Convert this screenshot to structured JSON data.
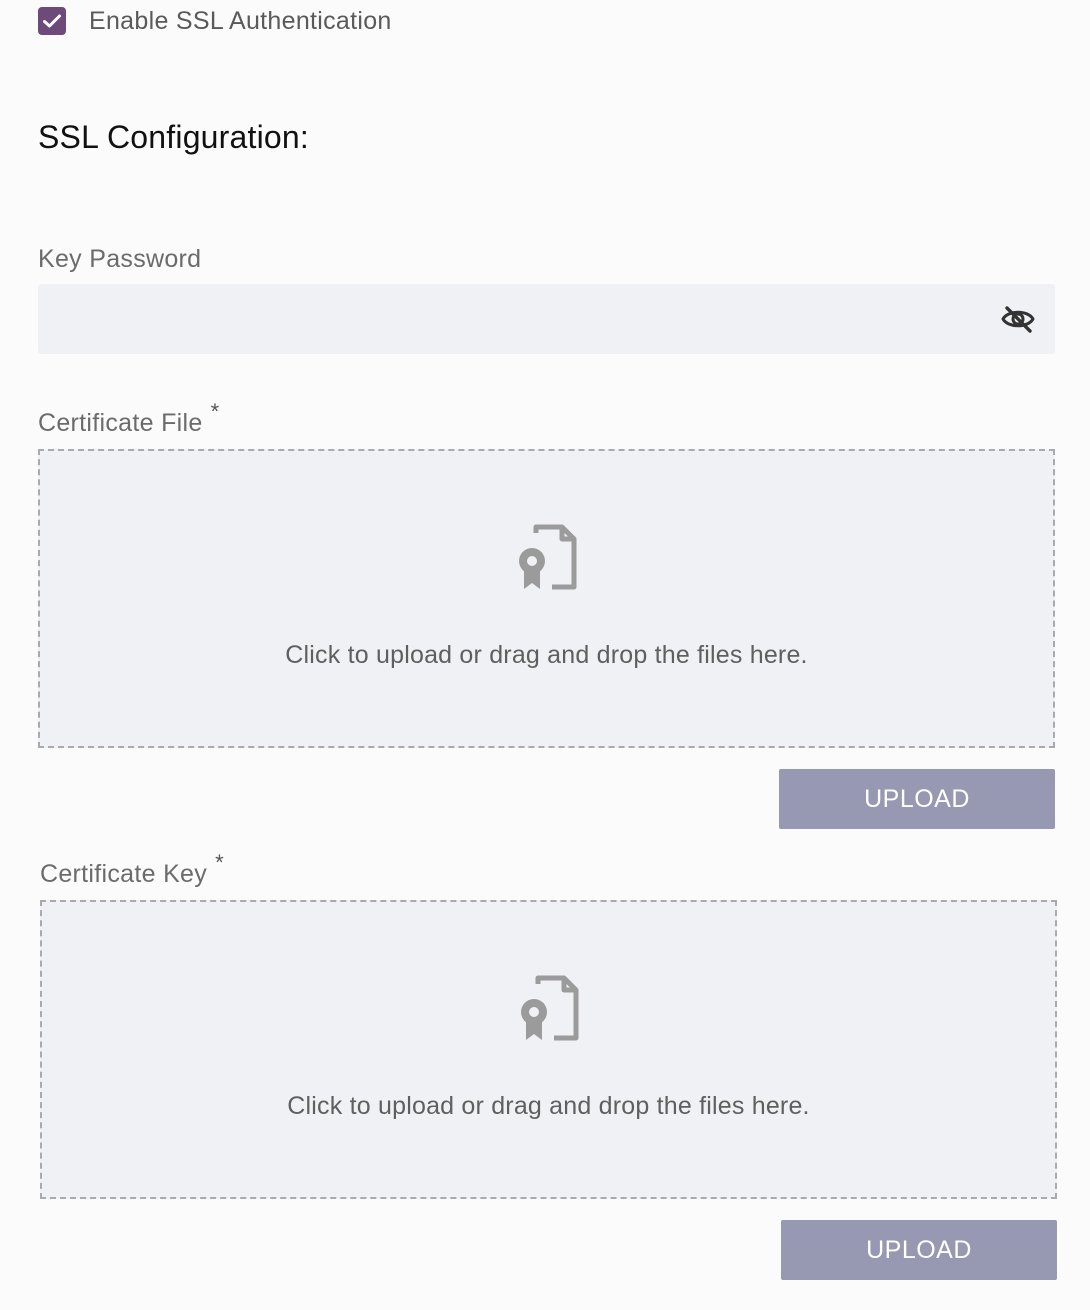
{
  "ssl_toggle": {
    "label": "Enable SSL Authentication",
    "checked": true,
    "checkbox_color": "#6e4a7a"
  },
  "section": {
    "title": "SSL Configuration:"
  },
  "key_password": {
    "label": "Key Password",
    "value": "",
    "toggle_icon": "eye-slash-icon"
  },
  "certificate_file": {
    "label": "Certificate File",
    "required_mark": "*",
    "dropzone_icon": "certificate-file-icon",
    "dropzone_text": "Click to upload or drag and drop the files here.",
    "button_label": "UPLOAD"
  },
  "certificate_key": {
    "label": "Certificate Key",
    "required_mark": "*",
    "dropzone_icon": "certificate-file-icon",
    "dropzone_text": "Click to upload or drag and drop the files here.",
    "button_label": "UPLOAD"
  },
  "colors": {
    "accent": "#6e4a7a",
    "input_background": "#f0f1f4",
    "upload_button": "#9798b2",
    "dropzone_border": "#a9a9ae"
  }
}
